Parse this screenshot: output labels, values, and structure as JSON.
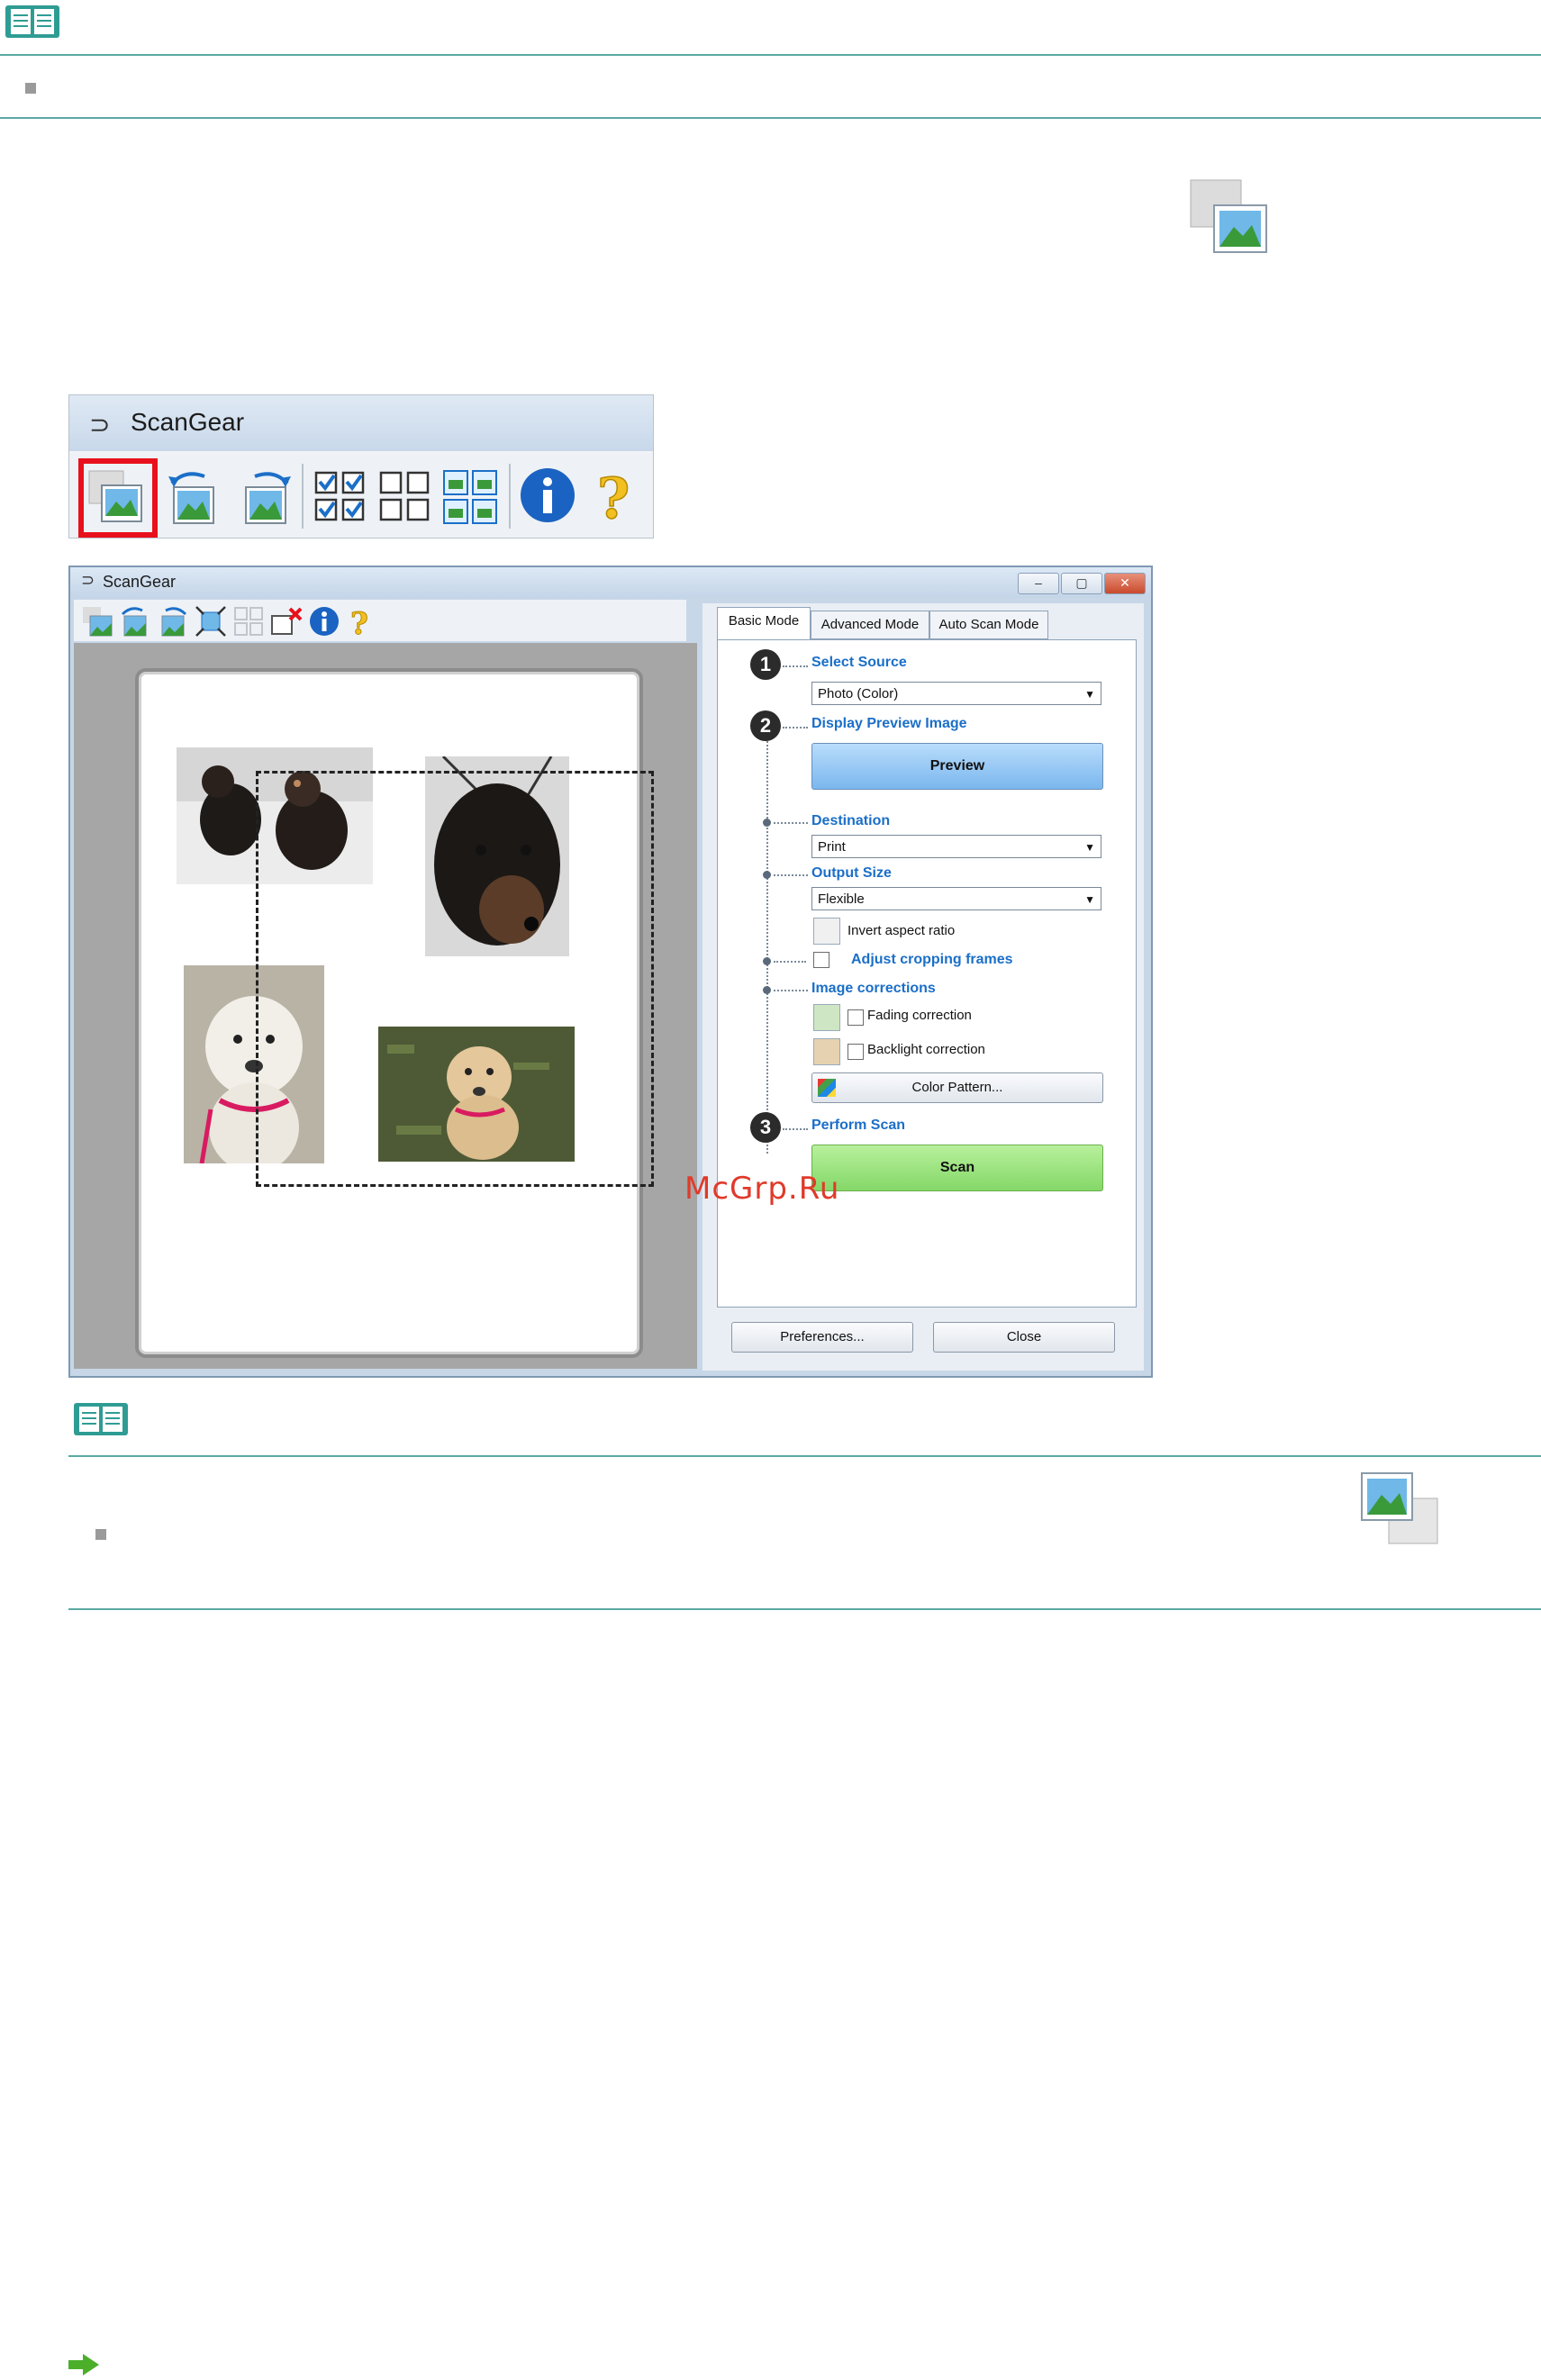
{
  "toolbar_crop": {
    "title": "ScanGear"
  },
  "window": {
    "title": "ScanGear",
    "tabs": [
      "Basic Mode",
      "Advanced Mode",
      "Auto Scan Mode"
    ],
    "steps": {
      "one": "1",
      "two": "2",
      "three": "3"
    },
    "select_source_label": "Select Source",
    "select_source_value": "Photo (Color)",
    "display_preview_label": "Display Preview Image",
    "preview_button": "Preview",
    "destination_label": "Destination",
    "destination_value": "Print",
    "output_size_label": "Output Size",
    "output_size_value": "Flexible",
    "invert_label": "Invert aspect ratio",
    "adjust_cropping_label": "Adjust cropping frames",
    "image_corrections_label": "Image corrections",
    "fading_label": "Fading correction",
    "backlight_label": "Backlight correction",
    "color_pattern_button": "Color Pattern...",
    "perform_scan_label": "Perform Scan",
    "scan_button": "Scan",
    "preferences_button": "Preferences...",
    "close_button": "Close"
  },
  "watermark": "McGrp.Ru",
  "colors": {
    "accent_rule": "#5aa9a2",
    "highlight": "#e8101c",
    "section_blue": "#1b6fc8",
    "preview_button": "#8ec4f2",
    "scan_button": "#9be07a"
  }
}
